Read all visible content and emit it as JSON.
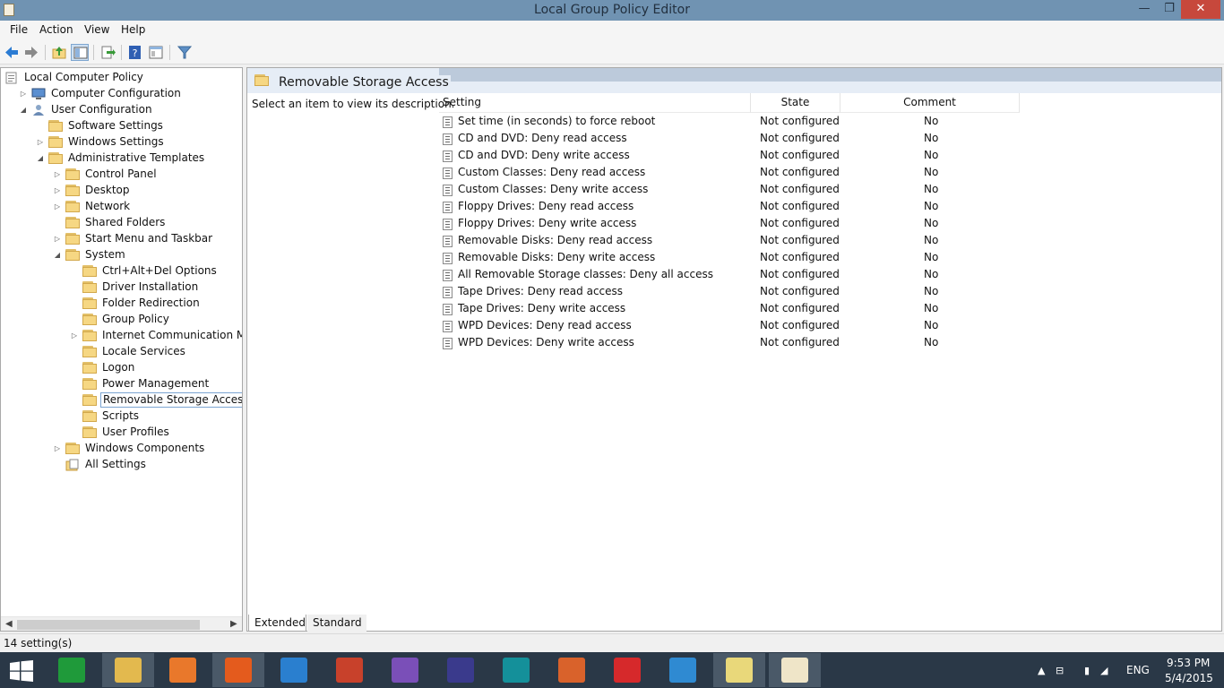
{
  "window": {
    "title": "Local Group Policy Editor",
    "minimize": "—",
    "maximize": "❐",
    "close": "✕"
  },
  "menu": [
    "File",
    "Action",
    "View",
    "Help"
  ],
  "toolbar": [
    "back-icon",
    "forward-icon",
    "up-folder-icon",
    "show-hide-tree-icon",
    "export-list-icon",
    "help-icon",
    "properties-icon",
    "filter-icon"
  ],
  "tree": [
    {
      "label": "Local Computer Policy",
      "level": 0,
      "expander": "",
      "icon": "policy-icon"
    },
    {
      "label": "Computer Configuration",
      "level": 1,
      "expander": "▷",
      "icon": "computer-icon"
    },
    {
      "label": "User Configuration",
      "level": 1,
      "expander": "◢",
      "icon": "user-icon"
    },
    {
      "label": "Software Settings",
      "level": 2,
      "expander": "",
      "icon": "folder-icon"
    },
    {
      "label": "Windows Settings",
      "level": 2,
      "expander": "▷",
      "icon": "folder-icon"
    },
    {
      "label": "Administrative Templates",
      "level": 2,
      "expander": "◢",
      "icon": "folder-icon"
    },
    {
      "label": "Control Panel",
      "level": 3,
      "expander": "▷",
      "icon": "folder-icon"
    },
    {
      "label": "Desktop",
      "level": 3,
      "expander": "▷",
      "icon": "folder-icon"
    },
    {
      "label": "Network",
      "level": 3,
      "expander": "▷",
      "icon": "folder-icon"
    },
    {
      "label": "Shared Folders",
      "level": 3,
      "expander": "",
      "icon": "folder-icon"
    },
    {
      "label": "Start Menu and Taskbar",
      "level": 3,
      "expander": "▷",
      "icon": "folder-icon"
    },
    {
      "label": "System",
      "level": 3,
      "expander": "◢",
      "icon": "folder-icon"
    },
    {
      "label": "Ctrl+Alt+Del Options",
      "level": 4,
      "expander": "",
      "icon": "folder-icon"
    },
    {
      "label": "Driver Installation",
      "level": 4,
      "expander": "",
      "icon": "folder-icon"
    },
    {
      "label": "Folder Redirection",
      "level": 4,
      "expander": "",
      "icon": "folder-icon"
    },
    {
      "label": "Group Policy",
      "level": 4,
      "expander": "",
      "icon": "folder-icon"
    },
    {
      "label": "Internet Communication Manag",
      "level": 4,
      "expander": "▷",
      "icon": "folder-icon"
    },
    {
      "label": "Locale Services",
      "level": 4,
      "expander": "",
      "icon": "folder-icon"
    },
    {
      "label": "Logon",
      "level": 4,
      "expander": "",
      "icon": "folder-icon"
    },
    {
      "label": "Power Management",
      "level": 4,
      "expander": "",
      "icon": "folder-icon"
    },
    {
      "label": "Removable Storage Access",
      "level": 4,
      "expander": "",
      "icon": "folder-icon",
      "selected": true
    },
    {
      "label": "Scripts",
      "level": 4,
      "expander": "",
      "icon": "folder-icon"
    },
    {
      "label": "User Profiles",
      "level": 4,
      "expander": "",
      "icon": "folder-icon"
    },
    {
      "label": "Windows Components",
      "level": 3,
      "expander": "▷",
      "icon": "folder-icon"
    },
    {
      "label": "All Settings",
      "level": 3,
      "expander": "",
      "icon": "all-settings-icon"
    }
  ],
  "right": {
    "header_title": "Removable Storage Access",
    "description": "Select an item to view its description.",
    "columns": {
      "setting": "Setting",
      "state": "State",
      "comment": "Comment"
    },
    "rows": [
      {
        "setting": "Set time (in seconds) to force reboot",
        "state": "Not configured",
        "comment": "No"
      },
      {
        "setting": "CD and DVD: Deny read access",
        "state": "Not configured",
        "comment": "No"
      },
      {
        "setting": "CD and DVD: Deny write access",
        "state": "Not configured",
        "comment": "No"
      },
      {
        "setting": "Custom Classes: Deny read access",
        "state": "Not configured",
        "comment": "No"
      },
      {
        "setting": "Custom Classes: Deny write access",
        "state": "Not configured",
        "comment": "No"
      },
      {
        "setting": "Floppy Drives: Deny read access",
        "state": "Not configured",
        "comment": "No"
      },
      {
        "setting": "Floppy Drives: Deny write access",
        "state": "Not configured",
        "comment": "No"
      },
      {
        "setting": "Removable Disks: Deny read access",
        "state": "Not configured",
        "comment": "No"
      },
      {
        "setting": "Removable Disks: Deny write access",
        "state": "Not configured",
        "comment": "No"
      },
      {
        "setting": "All Removable Storage classes: Deny all access",
        "state": "Not configured",
        "comment": "No"
      },
      {
        "setting": "Tape Drives: Deny read access",
        "state": "Not configured",
        "comment": "No"
      },
      {
        "setting": "Tape Drives: Deny write access",
        "state": "Not configured",
        "comment": "No"
      },
      {
        "setting": "WPD Devices: Deny read access",
        "state": "Not configured",
        "comment": "No"
      },
      {
        "setting": "WPD Devices: Deny write access",
        "state": "Not configured",
        "comment": "No"
      }
    ]
  },
  "tabs": {
    "extended": "Extended",
    "standard": "Standard"
  },
  "status": {
    "text": "14 setting(s)"
  },
  "taskbar": {
    "apps": [
      {
        "name": "store-app",
        "color": "#1f9a3a",
        "active": false
      },
      {
        "name": "file-explorer-app",
        "color": "#e3b94e",
        "active": true
      },
      {
        "name": "media-player-app",
        "color": "#e9782b",
        "active": false
      },
      {
        "name": "firefox-app",
        "color": "#e45b1d",
        "active": true
      },
      {
        "name": "typing-app",
        "color": "#2a7fcf",
        "active": false
      },
      {
        "name": "office-app",
        "color": "#c8412b",
        "active": false
      },
      {
        "name": "visual-studio-app",
        "color": "#7a4fb8",
        "active": false
      },
      {
        "name": "eclipse-app",
        "color": "#3a3a8c",
        "active": false
      },
      {
        "name": "arduino-app",
        "color": "#14909a",
        "active": false
      },
      {
        "name": "matlab-app",
        "color": "#d9622b",
        "active": false
      },
      {
        "name": "foxit-app",
        "color": "#d6292b",
        "active": false
      },
      {
        "name": "vmware-app",
        "color": "#2f8ad2",
        "active": false
      },
      {
        "name": "sticky-notes-app",
        "color": "#e9d87a",
        "active": true
      },
      {
        "name": "group-policy-app",
        "color": "#efe5c8",
        "active": true
      }
    ],
    "lang": "ENG",
    "time": "9:53 PM",
    "date": "5/4/2015"
  }
}
